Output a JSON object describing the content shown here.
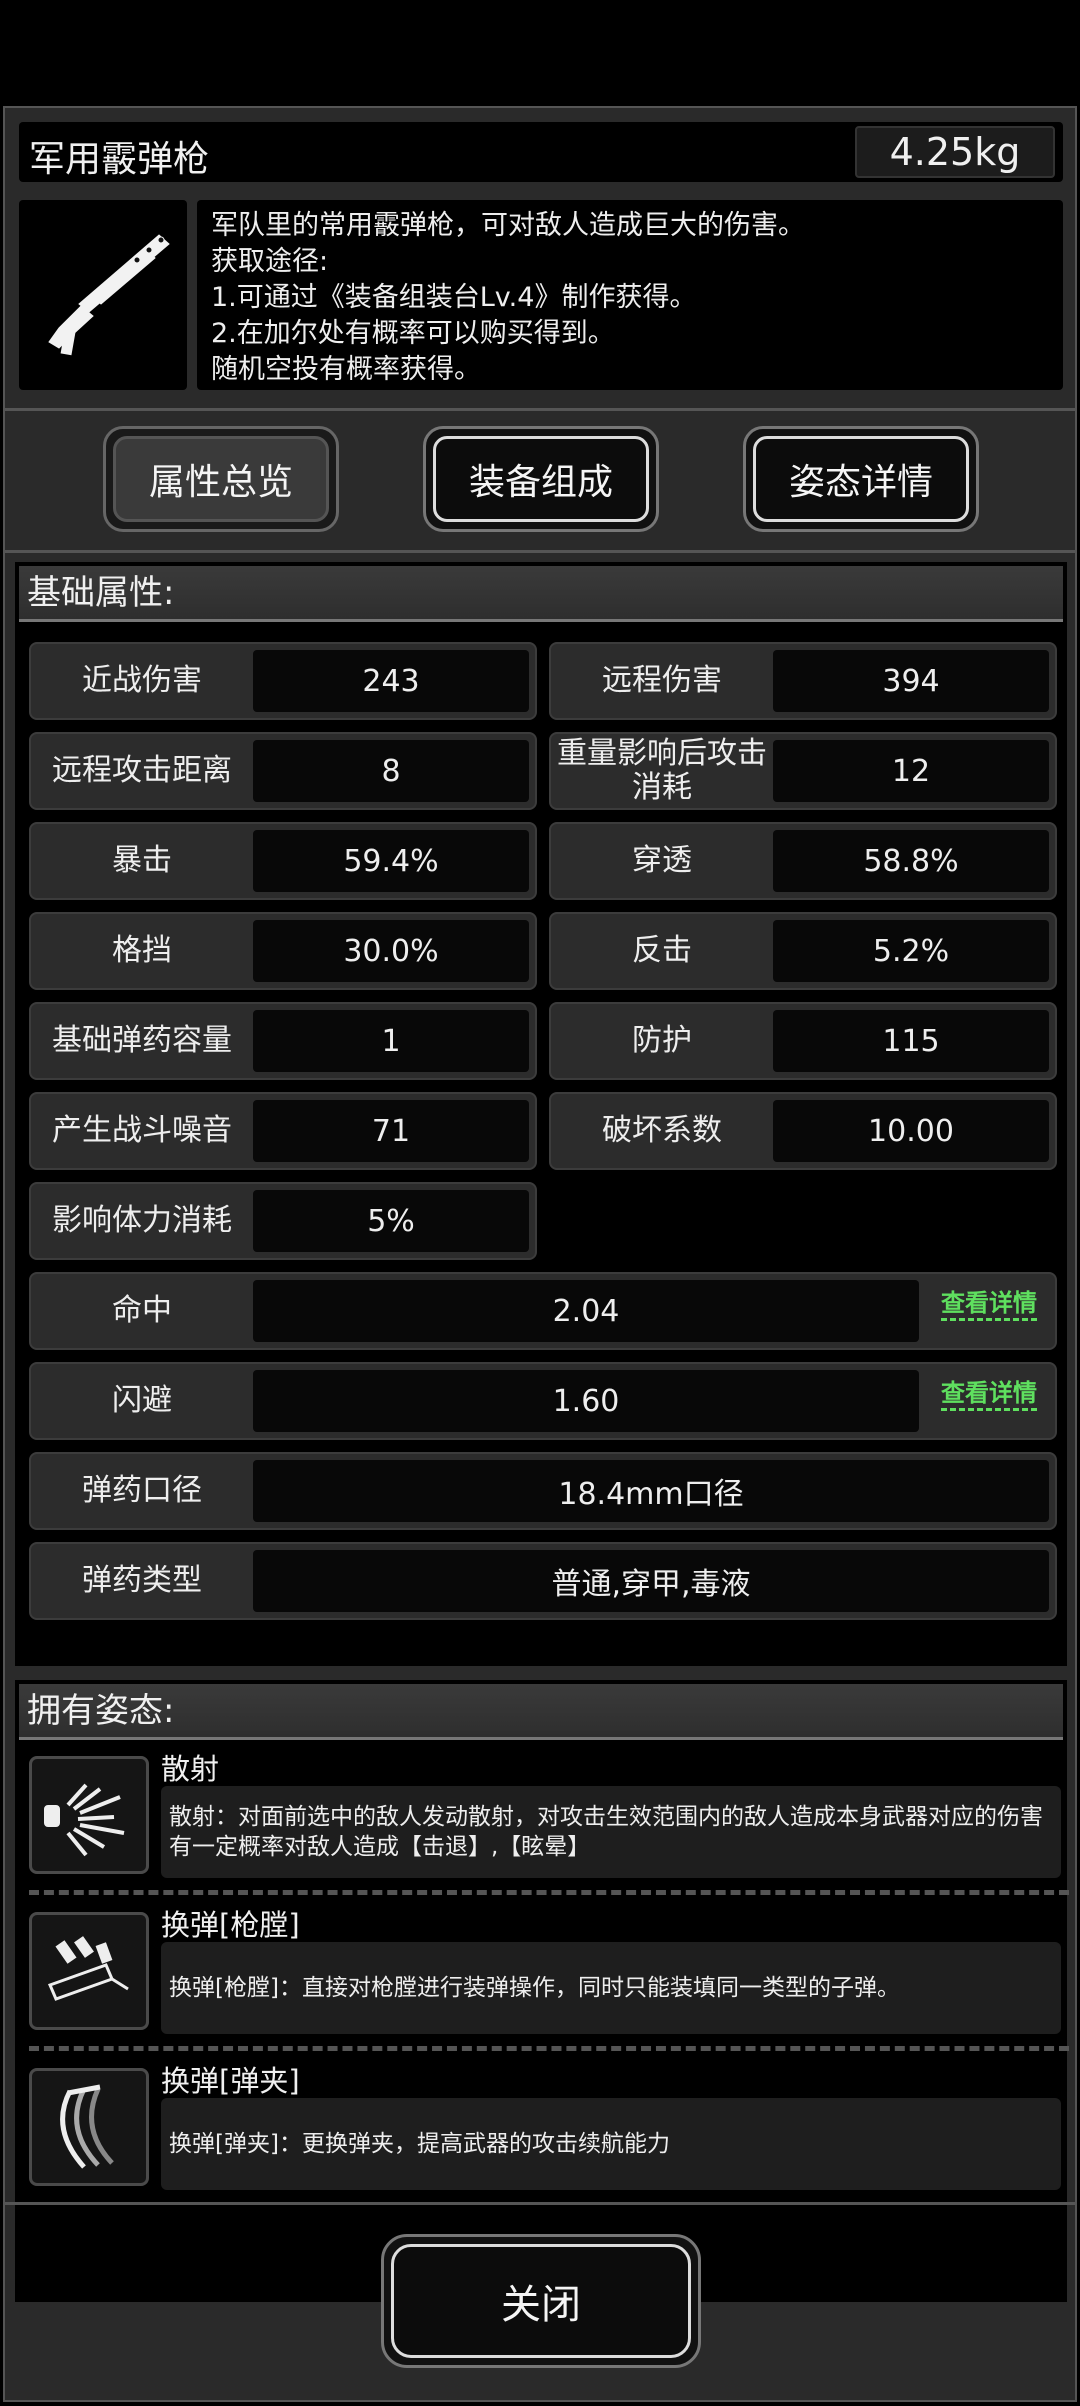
{
  "item": {
    "name": "军用霰弹枪",
    "weight": "4.25kg",
    "description": [
      "军队里的常用霰弹枪，可对敌人造成巨大的伤害。",
      "获取途径:",
      "1.可通过《装备组装台Lv.4》制作获得。",
      "2.在加尔处有概率可以购买得到。",
      "随机空投有概率获得。"
    ]
  },
  "tabs": [
    "属性总览",
    "装备组成",
    "姿态详情"
  ],
  "basic": {
    "header": "基础属性:",
    "stats": [
      {
        "label": "近战伤害",
        "value": "243"
      },
      {
        "label": "远程伤害",
        "value": "394"
      },
      {
        "label": "远程攻击距离",
        "value": "8"
      },
      {
        "label": "重量影响后攻击消耗",
        "value": "12"
      },
      {
        "label": "暴击",
        "value": "59.4%"
      },
      {
        "label": "穿透",
        "value": "58.8%"
      },
      {
        "label": "格挡",
        "value": "30.0%"
      },
      {
        "label": "反击",
        "value": "5.2%"
      },
      {
        "label": "基础弹药容量",
        "value": "1"
      },
      {
        "label": "防护",
        "value": "115"
      },
      {
        "label": "产生战斗噪音",
        "value": "71"
      },
      {
        "label": "破坏系数",
        "value": "10.00"
      },
      {
        "label": "影响体力消耗",
        "value": "5%"
      }
    ],
    "wide": [
      {
        "label": "命中",
        "value": "2.04",
        "detail": "查看详情"
      },
      {
        "label": "闪避",
        "value": "1.60",
        "detail": "查看详情"
      },
      {
        "label": "弹药口径",
        "value": "18.4mm口径"
      },
      {
        "label": "弹药类型",
        "value": "普通,穿甲,毒液"
      }
    ]
  },
  "stances": {
    "header": "拥有姿态:",
    "items": [
      {
        "name": "散射",
        "icon": "scatter-shot-icon",
        "lines": [
          "散射：对面前选中的敌人发动散射，对攻击生效范围内的敌人造成本身武器对应的伤害",
          "有一定概率对敌人造成【击退】,【眩晕】"
        ]
      },
      {
        "name": "换弹[枪膛]",
        "icon": "chamber-reload-icon",
        "lines": [
          "换弹[枪膛]：直接对枪膛进行装弹操作，同时只能装填同一类型的子弹。"
        ]
      },
      {
        "name": "换弹[弹夹]",
        "icon": "magazine-reload-icon",
        "lines": [
          "换弹[弹夹]：更换弹夹，提高武器的攻击续航能力"
        ]
      }
    ]
  },
  "close_label": "关闭"
}
